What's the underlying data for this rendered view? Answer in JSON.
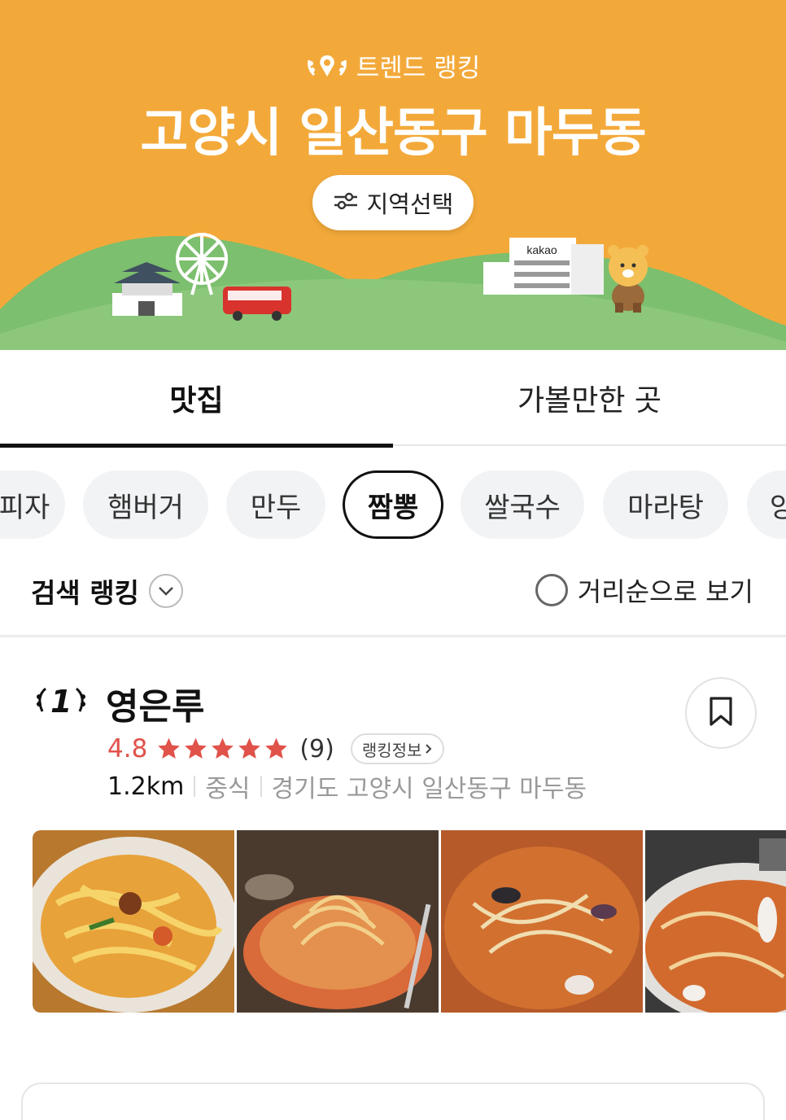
{
  "banner": {
    "trend_label": "트렌드 랭킹",
    "region_title": "고양시 일산동구 마두동",
    "region_button": "지역선택",
    "building_sign": "kakao",
    "background_color": "#F3A93A"
  },
  "tabs": [
    {
      "label": "맛집",
      "active": true
    },
    {
      "label": "가볼만한 곳",
      "active": false
    }
  ],
  "categories": [
    {
      "label": "피자",
      "active": false
    },
    {
      "label": "햄버거",
      "active": false
    },
    {
      "label": "만두",
      "active": false
    },
    {
      "label": "짬뽕",
      "active": true
    },
    {
      "label": "쌀국수",
      "active": false
    },
    {
      "label": "마라탕",
      "active": false
    },
    {
      "label": "양",
      "active": false
    }
  ],
  "sort": {
    "ranking_label": "검색 랭킹",
    "distance_label": "거리순으로 보기",
    "distance_checked": false
  },
  "restaurant": {
    "rank": "1",
    "name": "영은루",
    "rating": "4.8",
    "stars": 5,
    "review_count": "(9)",
    "rank_info_label": "랭킹정보",
    "distance": "1.2km",
    "category": "중식",
    "address": "경기도 고양시 일산동구 마두동",
    "photos": [
      "udon-jjamppong-photo",
      "jjamppong-bowl-photo",
      "seafood-jjamppong-photo",
      "squid-jjamppong-photo"
    ]
  },
  "colors": {
    "accent_rating": "#E0524A",
    "star": "#E0524A",
    "hill": "#8CC77B"
  }
}
